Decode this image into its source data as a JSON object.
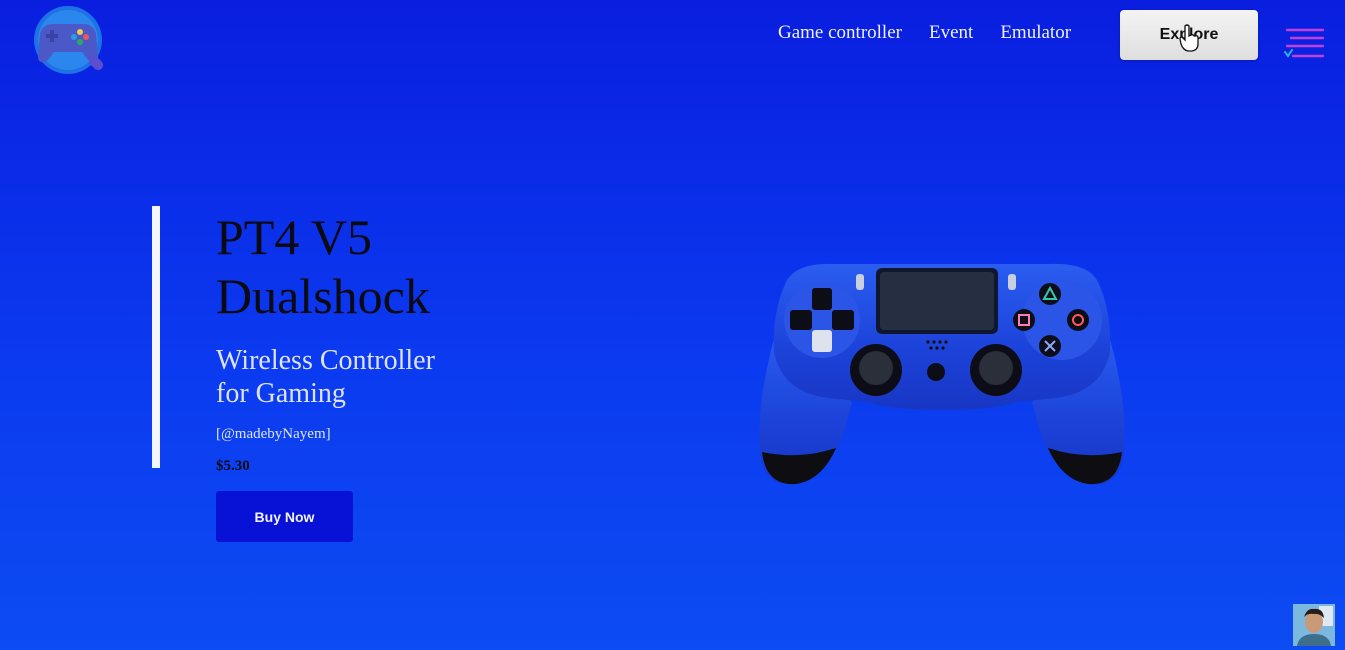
{
  "header": {
    "logo_icon": "gamepad-magnifier-logo",
    "nav": [
      {
        "label": "Game controller"
      },
      {
        "label": "Event"
      },
      {
        "label": "Emulator"
      }
    ],
    "explore_label": "Explore",
    "menu_icon": "menu-lines-icon"
  },
  "hero": {
    "title_line1": "PT4 V5",
    "title_line2": "Dualshock",
    "subtitle_line1": "Wireless Controller",
    "subtitle_line2": "for Gaming",
    "author": "[@madebyNayem]",
    "price": "$5.30",
    "buy_label": "Buy Now",
    "image_icon": "blue-dualshock-controller"
  },
  "colors": {
    "background": "#0b2ff0",
    "buy_button": "#0712d6",
    "explore_button": "#e9e9e9"
  }
}
